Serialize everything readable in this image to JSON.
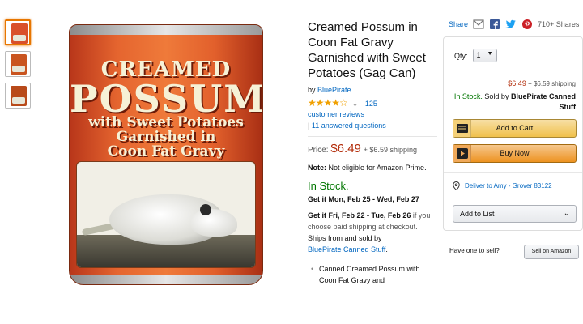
{
  "product": {
    "title": "Creamed Possum in Coon Fat Gravy Garnished with Sweet Potatoes (Gag Can)",
    "by_prefix": "by",
    "brand": "BluePirate",
    "stars": "★★★★☆",
    "review_count": "125",
    "reviews_label": "customer reviews",
    "answered": "11 answered questions",
    "price_label": "Price:",
    "price": "$6.49",
    "shipping": "+ $6.59 shipping",
    "note_label": "Note:",
    "note_text": "Not eligible for Amazon Prime.",
    "in_stock": "In Stock.",
    "delivery_1": "Get it Mon, Feb 25 - Wed, Feb 27",
    "delivery_2_bold": "Get it Fri, Feb 22 - Tue, Feb 26",
    "delivery_2_rest": "if you choose paid shipping at checkout.",
    "ships_from": "Ships from and sold by",
    "ships_seller": "BluePirate Canned Stuff",
    "ships_end": ".",
    "bullet_1": "Canned Creamed Possum with Coon Fat Gravy and"
  },
  "image": {
    "line1": "CREAMED",
    "line2": "POSSUM",
    "line3": "with Sweet Potatoes",
    "line4": "Garnished in",
    "line5": "Coon Fat Gravy"
  },
  "share": {
    "label": "Share",
    "count": "710+ Shares"
  },
  "buybox": {
    "qty_label": "Qty:",
    "qty_value": "1",
    "price": "$6.49",
    "shipping": "+ $6.59 shipping",
    "in_stock": "In Stock.",
    "sold_by": "Sold by",
    "seller": "BluePirate Canned Stuff",
    "add_to_cart": "Add to Cart",
    "buy_now": "Buy Now",
    "deliver_to": "Deliver to Amy - Grover 83122",
    "add_to_list": "Add to List"
  },
  "sell": {
    "prompt": "Have one to sell?",
    "button": "Sell on Amazon"
  },
  "colors": {
    "link": "#0066c0",
    "price": "#b12704",
    "stock": "#007600",
    "cart_button": "#f0c14b",
    "buy_button": "#ed9220",
    "thumb_active": "#e77600"
  }
}
